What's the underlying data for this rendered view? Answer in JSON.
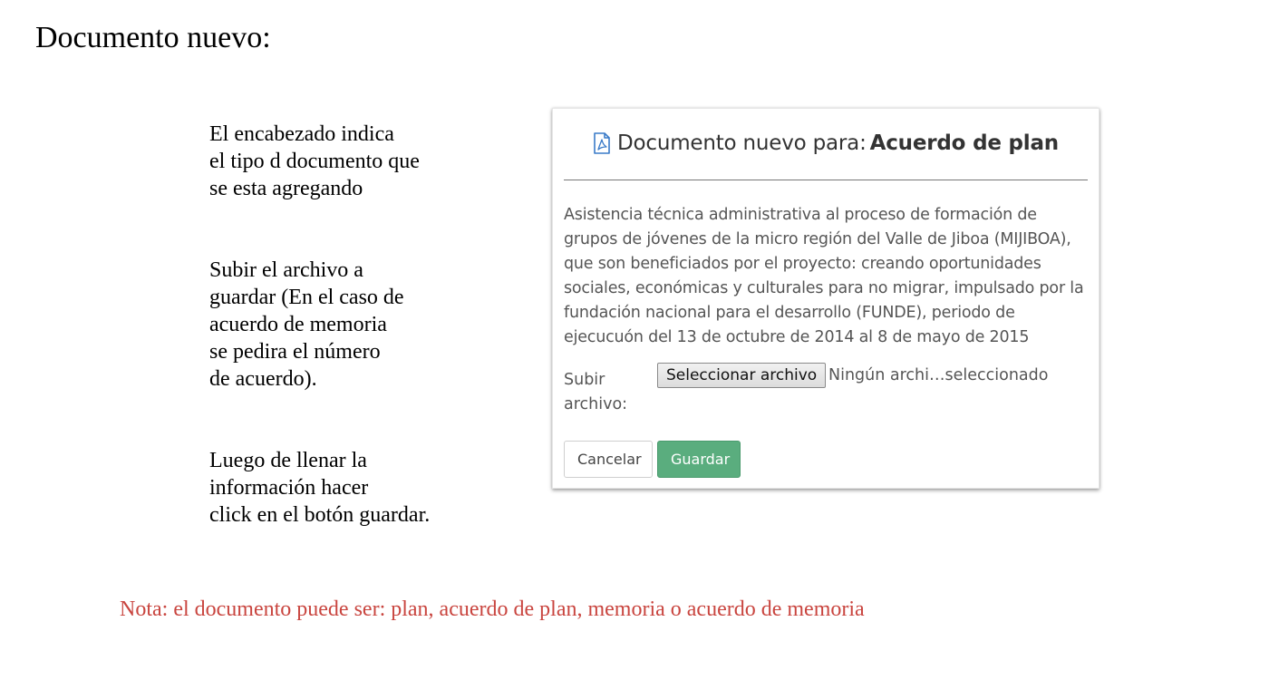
{
  "heading": "Documento nuevo:",
  "explanations": [
    "El encabezado indica\nel tipo d documento que\nse esta agregando",
    "Subir el archivo a\nguardar (En el caso de\nacuerdo de memoria\nse pedira el número\nde acuerdo).",
    "Luego de llenar la\ninformación hacer\nclick en el botón guardar."
  ],
  "note": "Nota: el documento puede ser: plan, acuerdo de plan, memoria o acuerdo de memoria",
  "modal": {
    "title_icon": "pdf-file-icon",
    "title_prefix": "Documento nuevo para: ",
    "title_strong": "Acuerdo de plan",
    "description": "Asistencia técnica administrativa al proceso de formación de grupos de jóvenes de la micro región del Valle de Jiboa (MIJIBOA), que son beneficiados por el proyecto: creando oportunidades sociales, económicas y culturales para no migrar, impulsado por la fundación nacional para el desarrollo (FUNDE), periodo de ejecucuón del 13 de octubre de 2014 al 8 de mayo de 2015",
    "file_label": "Subir archivo:",
    "file_button": "Seleccionar archivo",
    "file_status": "Ningún archi…seleccionado",
    "cancel_label": "Cancelar",
    "save_label": "Guardar"
  },
  "colors": {
    "note": "#c9453f",
    "save_button": "#5aad7e",
    "icon": "#3a7bc8"
  }
}
